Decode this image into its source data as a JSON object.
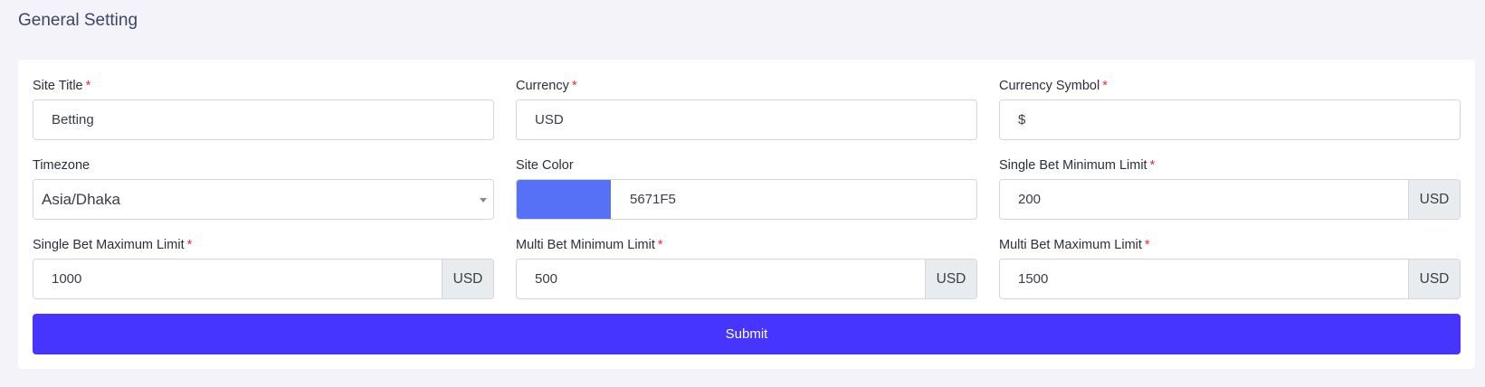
{
  "page": {
    "title": "General Setting"
  },
  "form": {
    "site_title": {
      "label": "Site Title",
      "value": "Betting"
    },
    "currency": {
      "label": "Currency",
      "value": "USD"
    },
    "currency_symbol": {
      "label": "Currency Symbol",
      "value": "$"
    },
    "timezone": {
      "label": "Timezone",
      "value": "Asia/Dhaka"
    },
    "site_color": {
      "label": "Site Color",
      "value": "5671F5",
      "swatch": "#5671F5"
    },
    "single_bet_min": {
      "label": "Single Bet Minimum Limit",
      "value": "200",
      "addon": "USD"
    },
    "single_bet_max": {
      "label": "Single Bet Maximum Limit",
      "value": "1000",
      "addon": "USD"
    },
    "multi_bet_min": {
      "label": "Multi Bet Minimum Limit",
      "value": "500",
      "addon": "USD"
    },
    "multi_bet_max": {
      "label": "Multi Bet Maximum Limit",
      "value": "1500",
      "addon": "USD"
    },
    "required_mark": "*",
    "submit_label": "Submit"
  },
  "colors": {
    "accent": "#4634FF",
    "swatch": "#5671F5",
    "required": "#e3342f"
  }
}
